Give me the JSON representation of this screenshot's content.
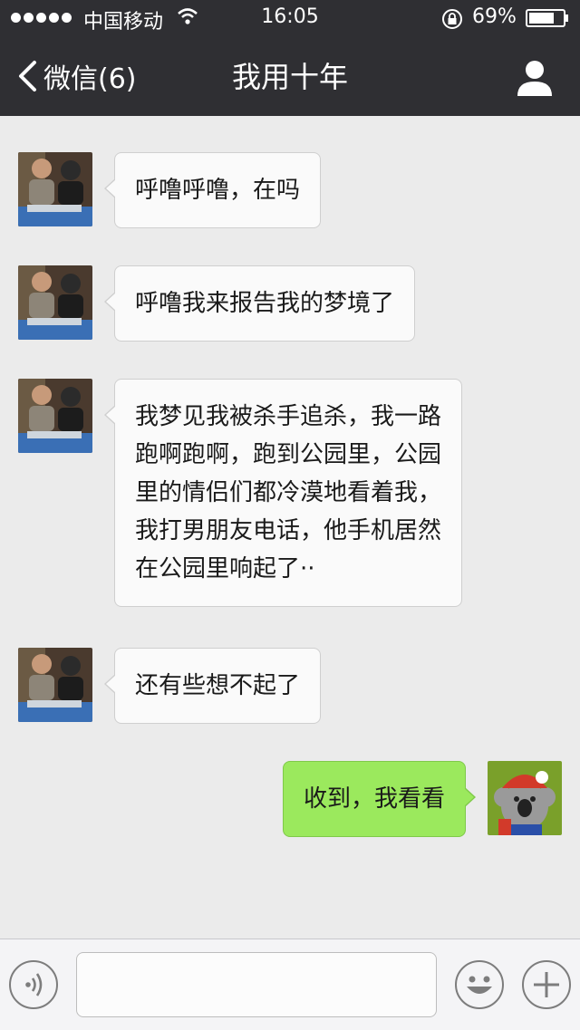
{
  "status_bar": {
    "carrier": "中国移动",
    "time": "16:05",
    "battery": "69%"
  },
  "nav": {
    "back_label": "微信(6)",
    "title": "我用十年"
  },
  "messages": [
    {
      "from": "friend",
      "text": "呼噜呼噜，在吗"
    },
    {
      "from": "friend",
      "text": "呼噜我来报告我的梦境了"
    },
    {
      "from": "friend",
      "lines": [
        "我梦见我被杀手追杀，我一路",
        "跑啊跑啊，跑到公园里，公园",
        "里的情侣们都冷漠地看着我，",
        "我打男朋友电话，他手机居然",
        "在公园里响起了··"
      ]
    },
    {
      "from": "friend",
      "text": "还有些想不起了"
    },
    {
      "from": "me",
      "text": "收到，我看看"
    }
  ],
  "input": {
    "value": "",
    "placeholder": ""
  },
  "icons": {
    "back": "chevron-left-icon",
    "profile": "person-icon",
    "voice": "voice-icon",
    "emoji": "smiley-icon",
    "more": "plus-icon"
  },
  "colors": {
    "nav_bg": "#2f2f33",
    "chat_bg": "#ebebeb",
    "incoming_bubble": "#fafafa",
    "outgoing_bubble": "#9be95d"
  }
}
